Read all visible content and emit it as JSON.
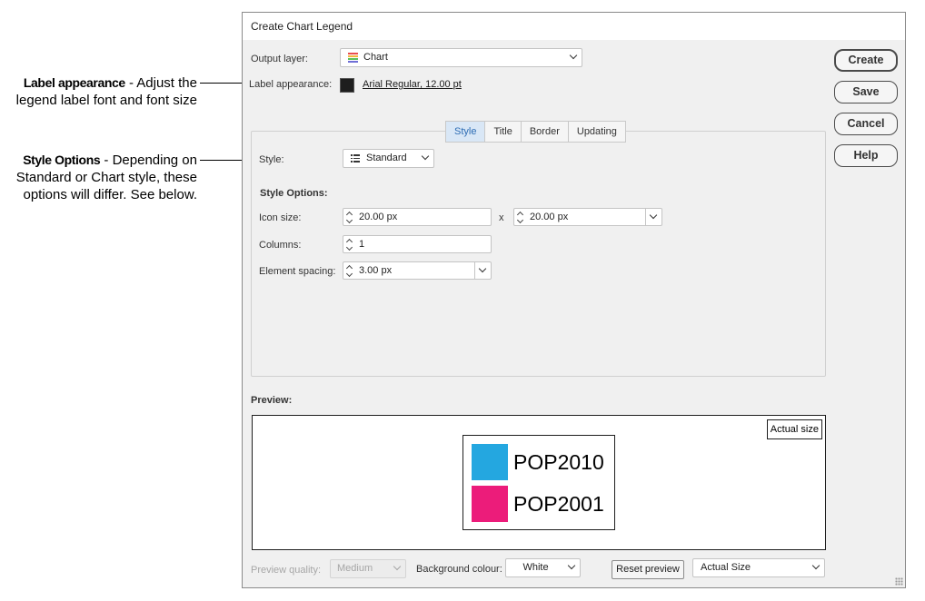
{
  "annotations": [
    {
      "title": "Label appearance",
      "lines": [
        " - Adjust the",
        "legend label font and font size"
      ]
    },
    {
      "title": "Style Options",
      "lines": [
        " - Depending on",
        "Standard or Chart style, these",
        "options will differ. See below."
      ]
    }
  ],
  "dialog": {
    "title": "Create Chart Legend",
    "output_layer": {
      "label": "Output layer:",
      "value": "Chart",
      "icon": "chart-layer-icon"
    },
    "label_appearance": {
      "label": "Label appearance:",
      "font": "Arial Regular, 12.00 pt",
      "swatch_color": "#1e1e1e"
    },
    "tabs": [
      {
        "label": "Style",
        "active": true
      },
      {
        "label": "Title",
        "active": false
      },
      {
        "label": "Border",
        "active": false
      },
      {
        "label": "Updating",
        "active": false
      }
    ],
    "style": {
      "label": "Style:",
      "value": "Standard",
      "icon": "list-icon"
    },
    "style_options": {
      "heading": "Style Options:",
      "icon_size": {
        "label": "Icon size:",
        "width": "20.00 px",
        "separator": "x",
        "height": "20.00 px"
      },
      "columns": {
        "label": "Columns:",
        "value": "1"
      },
      "element_spacing": {
        "label": "Element spacing:",
        "value": "3.00 px"
      }
    },
    "buttons": {
      "create": "Create",
      "save": "Save",
      "cancel": "Cancel",
      "help": "Help"
    },
    "preview": {
      "label": "Preview:",
      "actual_size_badge": "Actual size",
      "legend_items": [
        {
          "label": "POP2010",
          "color": "#24a7e0"
        },
        {
          "label": "POP2001",
          "color": "#ec1c7a"
        }
      ]
    },
    "bottom": {
      "preview_quality_label": "Preview quality:",
      "preview_quality_value": "Medium",
      "background_colour_label": "Background colour:",
      "background_colour_value": "White",
      "reset_preview": "Reset preview",
      "zoom_value": "Actual Size"
    }
  }
}
